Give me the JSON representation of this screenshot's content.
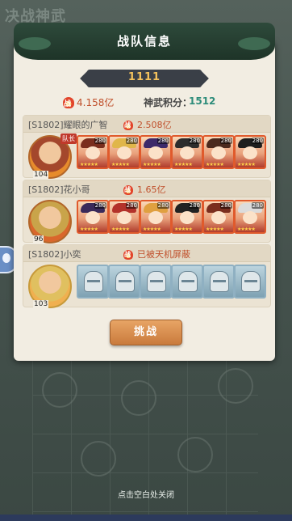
{
  "background": {
    "title": "决战神武"
  },
  "header": {
    "title": "战队信息"
  },
  "team": {
    "name": "1111",
    "power": "4.158亿",
    "score_label": "神武积分：",
    "score_value": "1512"
  },
  "members": [
    {
      "name": "[S1802]耀眼的广智",
      "power": "2.508亿",
      "leader_level": "104",
      "leader_tag": "队长",
      "heroes": [
        {
          "level": "280",
          "stars": "★★★★★",
          "hair": "#7a2e1e"
        },
        {
          "level": "280",
          "stars": "★★★★★",
          "hair": "#e0b64a"
        },
        {
          "level": "280",
          "stars": "★★★★★",
          "hair": "#3d2a6a"
        },
        {
          "level": "280",
          "stars": "★★★★★",
          "hair": "#2d2d2d"
        },
        {
          "level": "280",
          "stars": "★★★★★",
          "hair": "#4b2a1e"
        },
        {
          "level": "280",
          "stars": "★★★★★",
          "hair": "#1e1e1e"
        }
      ]
    },
    {
      "name": "[S1802]花小哥",
      "power": "1.65亿",
      "leader_level": "96",
      "heroes": [
        {
          "level": "280",
          "stars": "★★★★★",
          "hair": "#3a2a5a"
        },
        {
          "level": "280",
          "stars": "★★★★★",
          "hair": "#b3322a"
        },
        {
          "level": "280",
          "stars": "★★★★★",
          "hair": "#e0a040"
        },
        {
          "level": "280",
          "stars": "★★★★★",
          "hair": "#222222"
        },
        {
          "level": "280",
          "stars": "★★★★★",
          "hair": "#7a2e1e"
        },
        {
          "level": "280",
          "stars": "★★★★★",
          "hair": "#dcdcdc"
        }
      ]
    },
    {
      "name": "[S1802]小奕",
      "status": "已被天机屏蔽",
      "leader_level": "103",
      "heroes_hidden": 6
    }
  ],
  "challenge_button": "挑战",
  "close_hint": "点击空白处关闭",
  "colors": {
    "accent": "#c0502c",
    "score": "#2d8c7a",
    "button": "#d8924f"
  }
}
